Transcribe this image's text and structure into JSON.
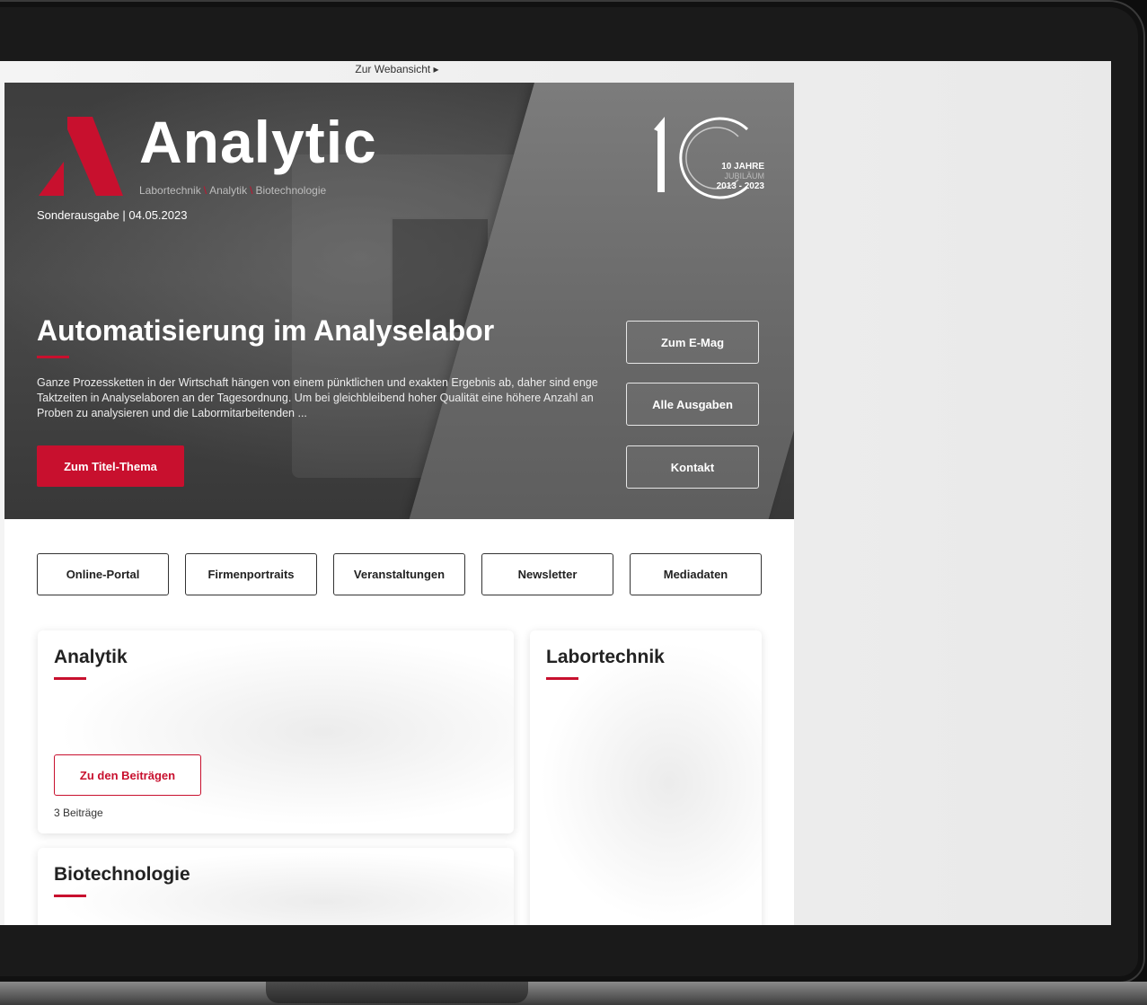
{
  "web_view_link": "Zur Webansicht ▸",
  "brand": {
    "name": "Analytic",
    "tagline_parts": [
      "Labortechnik",
      "Analytik",
      "Biotechnologie"
    ],
    "issue": "Sonderausgabe | 04.05.2023"
  },
  "jubilee": {
    "title": "10 JAHRE",
    "subtitle": "JUBILÄUM",
    "years": "2013 - 2023"
  },
  "hero": {
    "headline": "Automatisierung im Analyselabor",
    "teaser": "Ganze Prozessketten in der Wirtschaft hängen von einem pünktlichen und exakten Ergebnis ab, daher sind enge Taktzeiten in Analyselaboren an der Tagesordnung. Um bei gleichbleibend hoher Qualität eine höhere Anzahl an Proben zu analysieren und die Labormitarbeitenden ...",
    "cta_label": "Zum Titel-Thema",
    "side_buttons": [
      "Zum E-Mag",
      "Alle Ausgaben",
      "Kontakt"
    ]
  },
  "nav": [
    "Online-Portal",
    "Firmenportraits",
    "Veranstaltungen",
    "Newsletter",
    "Mediadaten"
  ],
  "cards": {
    "analytik": {
      "title": "Analytik",
      "button": "Zu den Beiträgen",
      "count": "3 Beiträge"
    },
    "labortechnik": {
      "title": "Labortechnik"
    },
    "biotechnologie": {
      "title": "Biotechnologie"
    }
  },
  "colors": {
    "accent": "#c8102e",
    "hero_dark": "#3d3d3d",
    "hero_light": "#7c7c7c"
  },
  "icons": [
    "triangle-a-logo-icon",
    "ten-years-badge-icon"
  ]
}
